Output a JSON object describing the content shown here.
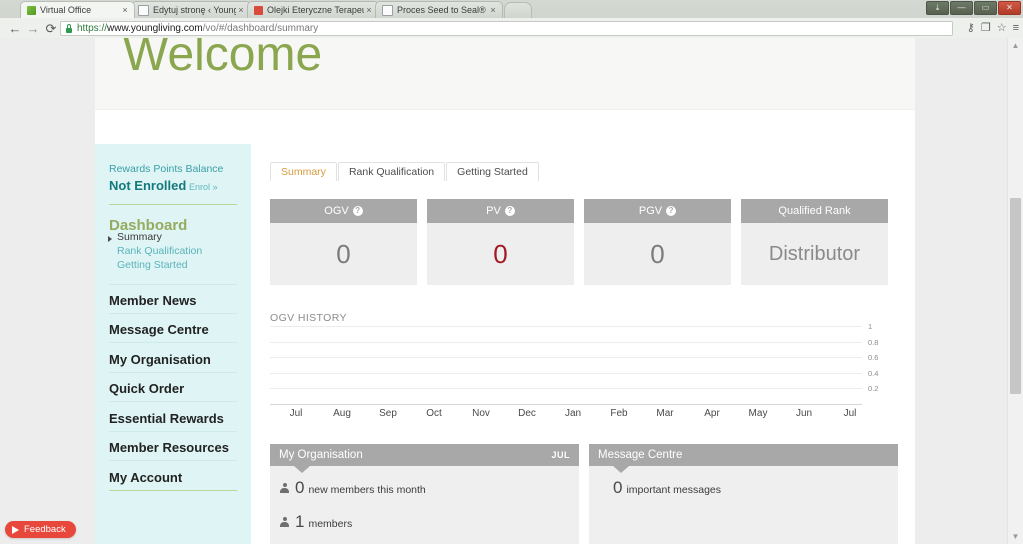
{
  "browser": {
    "tabs": [
      {
        "title": "Virtual Office",
        "favicon": "leaf-icon",
        "active": true,
        "close": "×"
      },
      {
        "title": "Edytuj stronę ‹ Young Liv",
        "favicon": "document-icon",
        "active": false,
        "close": "×"
      },
      {
        "title": "Olejki Eteryczne Terapeut",
        "favicon": "image-icon",
        "active": false,
        "close": "×"
      },
      {
        "title": "Proces Seed to Seal® – c…",
        "favicon": "document-icon",
        "active": false,
        "close": "×"
      }
    ],
    "window_controls": {
      "minimize": "—",
      "maximize": "▭",
      "close": "✕",
      "restore": "⤓"
    },
    "nav": {
      "back": "←",
      "forward": "→",
      "reload": "⟳"
    },
    "url": {
      "scheme": "https://",
      "domain": "www.youngliving.com",
      "path": "/vo/#/dashboard/summary",
      "lock": "secure-lock-icon"
    },
    "toolbar_icons": [
      "key-icon",
      "translate-icon",
      "bookmark-star-icon",
      "menu-hamburger-icon"
    ],
    "toolbar_glyphs": {
      "key": "⚷",
      "translate": "❐",
      "star": "☆",
      "menu": "≡"
    }
  },
  "header": {
    "welcome": "Welcome"
  },
  "sidebar": {
    "rewards_label": "Rewards Points Balance",
    "rewards_status": "Not Enrolled",
    "enrol_link": "Enrol »",
    "dashboard_label": "Dashboard",
    "sub_items": [
      {
        "label": "Summary",
        "current": true
      },
      {
        "label": "Rank Qualification",
        "current": false
      },
      {
        "label": "Getting Started",
        "current": false
      }
    ],
    "nav_items": [
      {
        "label": "Member News"
      },
      {
        "label": "Message Centre"
      },
      {
        "label": "My Organisation"
      },
      {
        "label": "Quick Order"
      },
      {
        "label": "Essential Rewards"
      },
      {
        "label": "Member Resources"
      },
      {
        "label": "My Account"
      }
    ]
  },
  "main": {
    "tabs": [
      {
        "label": "Summary",
        "active": true
      },
      {
        "label": "Rank Qualification",
        "active": false
      },
      {
        "label": "Getting Started",
        "active": false
      }
    ],
    "cards": [
      {
        "title": "OGV",
        "help": "?",
        "value": "0",
        "style": "plain"
      },
      {
        "title": "PV",
        "help": "?",
        "value": "0",
        "style": "red"
      },
      {
        "title": "PGV",
        "help": "?",
        "value": "0",
        "style": "plain"
      },
      {
        "title": "Qualified Rank",
        "help": "",
        "value": "Distributor",
        "style": "rank"
      }
    ],
    "panels": [
      {
        "title": "My Organisation",
        "badge": "JUL",
        "rows": [
          {
            "icon": "person-icon",
            "number": "0",
            "text": "new members this month"
          },
          {
            "icon": "person-icon",
            "number": "1",
            "text": "members"
          }
        ]
      },
      {
        "title": "Message Centre",
        "badge": "",
        "rows": [
          {
            "icon": "",
            "number": "0",
            "text": "important messages"
          }
        ]
      }
    ]
  },
  "chart_data": {
    "type": "line",
    "title": "OGV HISTORY",
    "xlabel": "",
    "ylabel": "",
    "categories": [
      "Jul",
      "Aug",
      "Sep",
      "Oct",
      "Nov",
      "Dec",
      "Jan",
      "Feb",
      "Mar",
      "Apr",
      "May",
      "Jun",
      "Jul"
    ],
    "series": [
      {
        "name": "OGV",
        "values": [
          0,
          0,
          0,
          0,
          0,
          0,
          0,
          0,
          0,
          0,
          0,
          0,
          0
        ]
      }
    ],
    "yticks": [
      "1",
      "0.8",
      "0.6",
      "0.4",
      "0.2"
    ],
    "ylim": [
      0,
      1
    ],
    "grid": true,
    "legend": "none"
  },
  "feedback": {
    "label": "Feedback",
    "icon": "play-triangle-icon",
    "color": "#e8483c"
  },
  "colors": {
    "accent_green": "#8aa64e",
    "sidebar_bg": "#dff4f4",
    "teal": "#147a7e",
    "card_head": "#a8a8a8",
    "red_value": "#a31a22",
    "tab_active_text": "#d79a3c"
  }
}
